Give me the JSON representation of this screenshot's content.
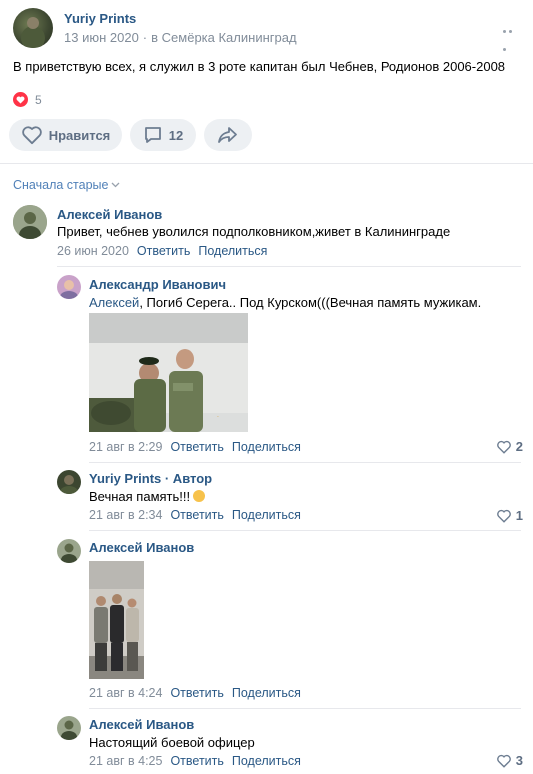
{
  "post": {
    "author": "Yuriy Prints",
    "date": "13 июн 2020",
    "location": "в Семёрка Калининград",
    "text": "В приветствую всех, я служил в 3 роте капитан был Чебнев, Родионов 2006-2008",
    "likes_count": "5",
    "like_label": "Нравится",
    "comments_count": "12"
  },
  "sort_label": "Сначала старые",
  "comments": [
    {
      "author": "Алексей Иванов",
      "text": "Привет, чебнев уволился подполковником,живет в Калининграде",
      "date": "26 июн 2020",
      "reply": "Ответить",
      "share": "Поделиться"
    },
    {
      "author": "Александр Иванович",
      "mention": "Алексей",
      "text": ", Погиб Серега.. Под Курском(((Вечная память мужикам.",
      "date": "21 авг в 2:29",
      "reply": "Ответить",
      "share": "Поделиться",
      "likes": "2"
    },
    {
      "author": "Yuriy Prints · Автор",
      "text": "Вечная память!!!",
      "date": "21 авг в 2:34",
      "reply": "Ответить",
      "share": "Поделиться",
      "likes": "1"
    },
    {
      "author": "Алексей Иванов",
      "date": "21 авг в 4:24",
      "reply": "Ответить",
      "share": "Поделиться"
    },
    {
      "author": "Алексей Иванов",
      "text": "Настоящий боевой офицер",
      "date": "21 авг в 4:25",
      "reply": "Ответить",
      "share": "Поделиться",
      "likes": "3"
    }
  ],
  "colors": {
    "link": "#2a5885",
    "accent": "#5181b8",
    "muted": "#818c99",
    "like_red": "#ff3347",
    "button_bg": "#edf0f3"
  },
  "icons": [
    "heart-icon",
    "comment-icon",
    "share-icon",
    "more-icon",
    "chevron-down-icon"
  ]
}
